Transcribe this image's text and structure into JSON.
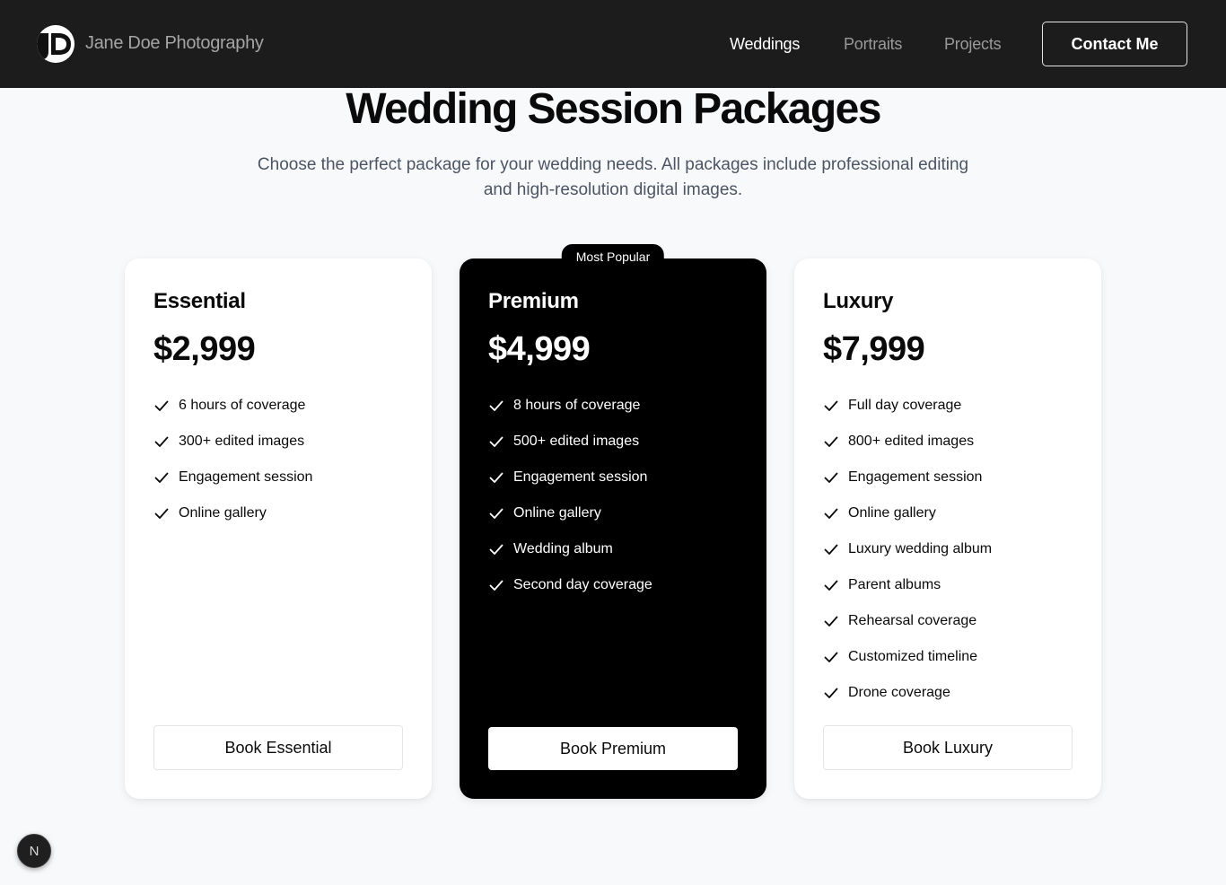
{
  "header": {
    "logo_icon": "jd-monogram-icon",
    "brand": "Jane Doe Photography",
    "nav": [
      {
        "label": "Weddings",
        "active": true
      },
      {
        "label": "Portraits",
        "active": false
      },
      {
        "label": "Projects",
        "active": false
      }
    ],
    "contact_label": "Contact Me"
  },
  "hero": {
    "title": "Wedding Session Packages",
    "subtitle": "Choose the perfect package for your wedding needs. All packages include professional editing and high-resolution digital images."
  },
  "packages": [
    {
      "name": "Essential",
      "price": "$2,999",
      "features": [
        "6 hours of coverage",
        "300+ edited images",
        "Engagement session",
        "Online gallery"
      ],
      "button": "Book Essential"
    },
    {
      "name": "Premium",
      "price": "$4,999",
      "badge": "Most Popular",
      "features": [
        "8 hours of coverage",
        "500+ edited images",
        "Engagement session",
        "Online gallery",
        "Wedding album",
        "Second day coverage"
      ],
      "button": "Book Premium"
    },
    {
      "name": "Luxury",
      "price": "$7,999",
      "features": [
        "Full day coverage",
        "800+ edited images",
        "Engagement session",
        "Online gallery",
        "Luxury wedding album",
        "Parent albums",
        "Rehearsal coverage",
        "Customized timeline",
        "Drone coverage"
      ],
      "button": "Book Luxury"
    }
  ],
  "dev_badge": {
    "label": "N",
    "icon": "nextjs-icon"
  },
  "colors": {
    "header_bg": "#1c1c1c",
    "accent": "#000000",
    "page_bg": "#f8f9fb",
    "muted_text": "#4b5563"
  }
}
